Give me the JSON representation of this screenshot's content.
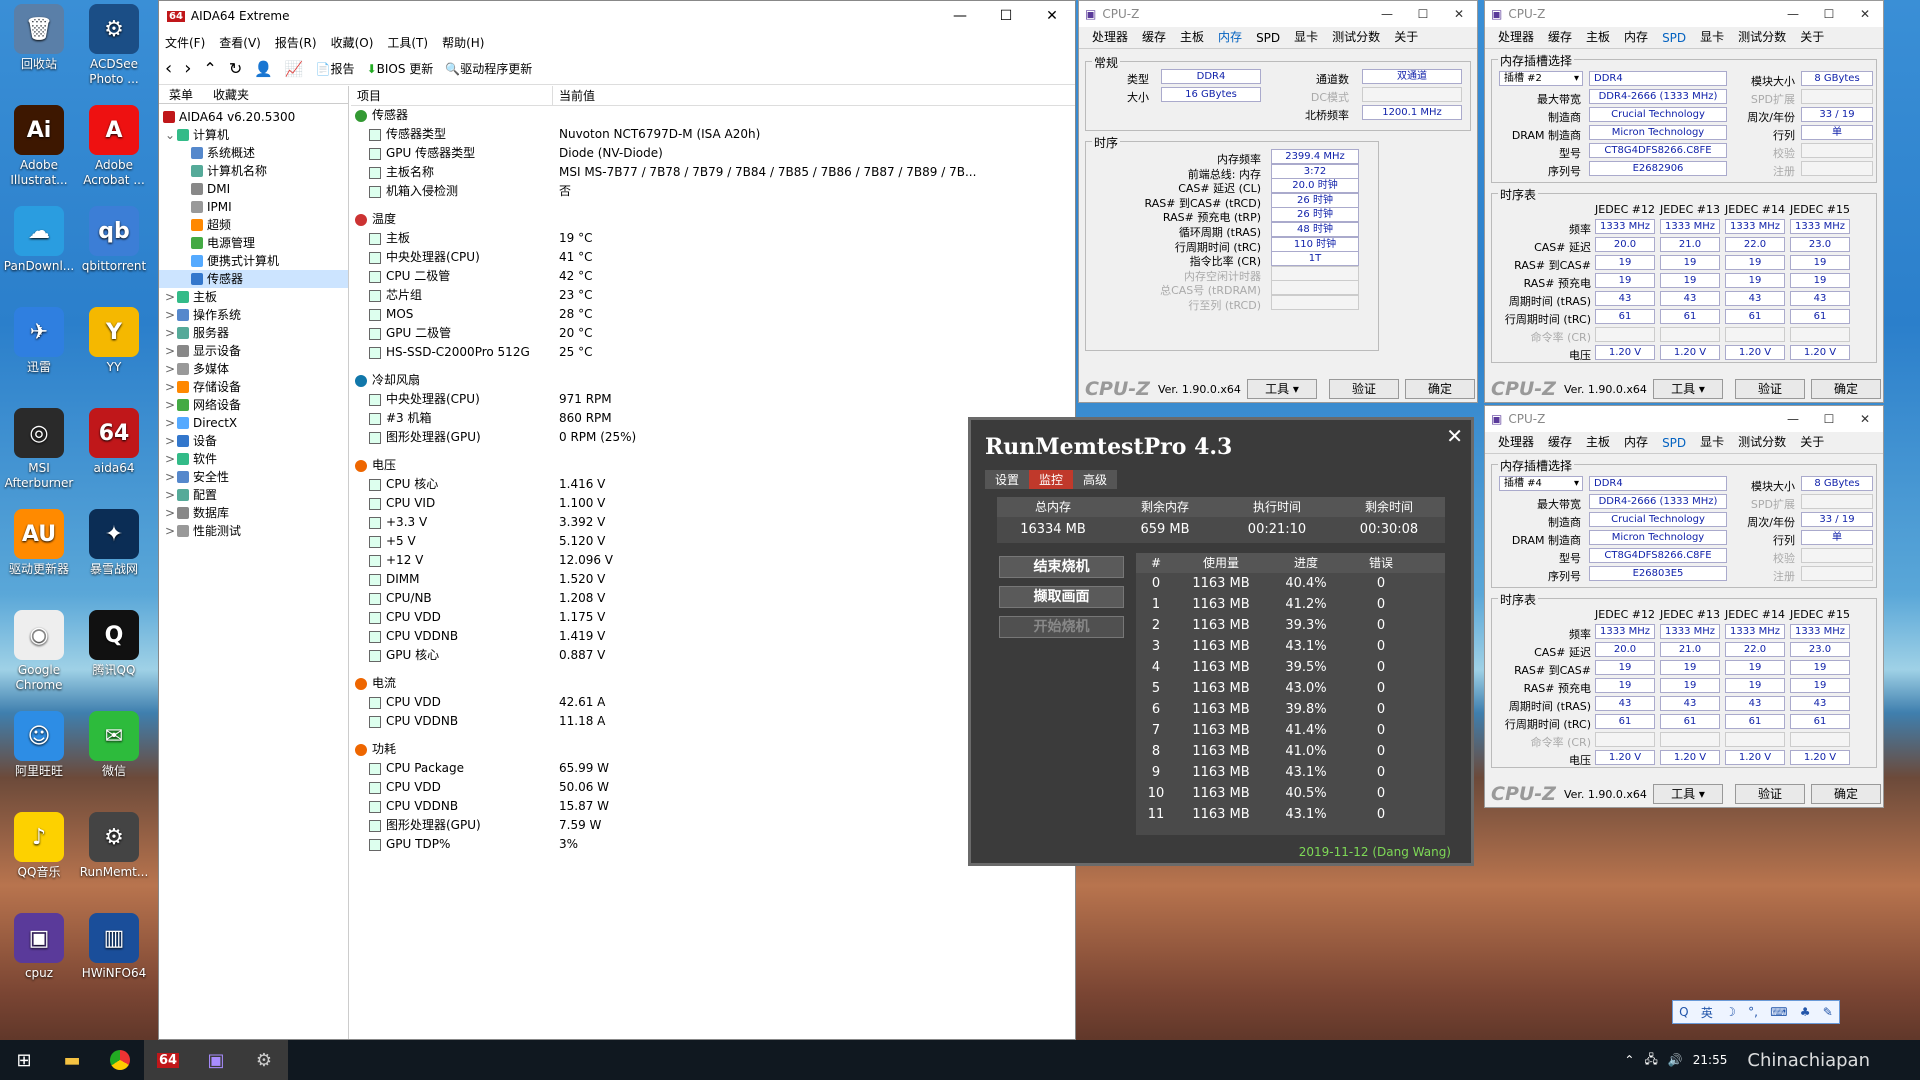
{
  "desktop": {
    "icons": [
      {
        "label": "回收站",
        "color": "#5a7fa8",
        "glyph": "🗑"
      },
      {
        "label": "ACDSee Photo ...",
        "color": "#1b4e86",
        "glyph": "⚙"
      },
      {
        "label": "Adobe Illustrat...",
        "color": "#3d1700",
        "glyph": "Ai"
      },
      {
        "label": "Adobe Acrobat ...",
        "color": "#e11",
        "glyph": "A"
      },
      {
        "label": "PanDownl...",
        "color": "#2a9de0",
        "glyph": "☁"
      },
      {
        "label": "qbittorrent",
        "color": "#3c7ed6",
        "glyph": "qb"
      },
      {
        "label": "迅雷",
        "color": "#2f7fe0",
        "glyph": "✈"
      },
      {
        "label": "YY",
        "color": "#f5b800",
        "glyph": "Y"
      },
      {
        "label": "MSI Afterburner",
        "color": "#2a2a2a",
        "glyph": "◎"
      },
      {
        "label": "aida64",
        "color": "#c0171a",
        "glyph": "64"
      },
      {
        "label": "驱动更新器",
        "color": "#ff8a00",
        "glyph": "AU"
      },
      {
        "label": "暴雪战网",
        "color": "#0b2d55",
        "glyph": "✦"
      },
      {
        "label": "Google Chrome",
        "color": "#eee",
        "glyph": "◉"
      },
      {
        "label": "腾讯QQ",
        "color": "#111",
        "glyph": "Q"
      },
      {
        "label": "阿里旺旺",
        "color": "#2d8de5",
        "glyph": "☺"
      },
      {
        "label": "微信",
        "color": "#2dbb3c",
        "glyph": "✉"
      },
      {
        "label": "QQ音乐",
        "color": "#fdd100",
        "glyph": "♪"
      },
      {
        "label": "RunMemt...",
        "color": "#444",
        "glyph": "⚙"
      },
      {
        "label": "cpuz",
        "color": "#5a3a9a",
        "glyph": "▣"
      },
      {
        "label": "HWiNFO64",
        "color": "#1a4e9a",
        "glyph": "▥"
      }
    ]
  },
  "aida": {
    "title": "AIDA64 Extreme",
    "menu": [
      "文件(F)",
      "查看(V)",
      "报告(R)",
      "收藏(O)",
      "工具(T)",
      "帮助(H)"
    ],
    "toolbar": {
      "report": "报告",
      "bios": "BIOS 更新",
      "driver": "驱动程序更新"
    },
    "tabs": [
      "菜单",
      "收藏夹"
    ],
    "tree_root": "AIDA64 v6.20.5300",
    "tree": [
      {
        "label": "计算机",
        "lvl": 1,
        "exp": "⌄"
      },
      {
        "label": "系统概述",
        "lvl": 2
      },
      {
        "label": "计算机名称",
        "lvl": 2
      },
      {
        "label": "DMI",
        "lvl": 2
      },
      {
        "label": "IPMI",
        "lvl": 2
      },
      {
        "label": "超频",
        "lvl": 2
      },
      {
        "label": "电源管理",
        "lvl": 2
      },
      {
        "label": "便携式计算机",
        "lvl": 2
      },
      {
        "label": "传感器",
        "lvl": 2,
        "sel": true
      },
      {
        "label": "主板",
        "lvl": 1,
        "exp": ">"
      },
      {
        "label": "操作系统",
        "lvl": 1,
        "exp": ">"
      },
      {
        "label": "服务器",
        "lvl": 1,
        "exp": ">"
      },
      {
        "label": "显示设备",
        "lvl": 1,
        "exp": ">"
      },
      {
        "label": "多媒体",
        "lvl": 1,
        "exp": ">"
      },
      {
        "label": "存储设备",
        "lvl": 1,
        "exp": ">"
      },
      {
        "label": "网络设备",
        "lvl": 1,
        "exp": ">"
      },
      {
        "label": "DirectX",
        "lvl": 1,
        "exp": ">"
      },
      {
        "label": "设备",
        "lvl": 1,
        "exp": ">"
      },
      {
        "label": "软件",
        "lvl": 1,
        "exp": ">"
      },
      {
        "label": "安全性",
        "lvl": 1,
        "exp": ">"
      },
      {
        "label": "配置",
        "lvl": 1,
        "exp": ">"
      },
      {
        "label": "数据库",
        "lvl": 1,
        "exp": ">"
      },
      {
        "label": "性能测试",
        "lvl": 1,
        "exp": ">"
      }
    ],
    "col_item": "项目",
    "col_value": "当前值",
    "sections": [
      {
        "title": "传感器",
        "rows": [
          [
            "传感器类型",
            "Nuvoton NCT6797D-M  (ISA A20h)"
          ],
          [
            "GPU 传感器类型",
            "Diode  (NV-Diode)"
          ],
          [
            "主板名称",
            "MSI MS-7B77 / 7B78 / 7B79 / 7B84 / 7B85 / 7B86 / 7B87 / 7B89 / 7B..."
          ],
          [
            "机箱入侵检测",
            "否"
          ]
        ]
      },
      {
        "title": "温度",
        "rows": [
          [
            "主板",
            "19 °C"
          ],
          [
            "中央处理器(CPU)",
            "41 °C"
          ],
          [
            "CPU 二极管",
            "42 °C"
          ],
          [
            "芯片组",
            "23 °C"
          ],
          [
            "MOS",
            "28 °C"
          ],
          [
            "GPU 二极管",
            "20 °C"
          ],
          [
            "HS-SSD-C2000Pro 512G",
            "25 °C"
          ]
        ]
      },
      {
        "title": "冷却风扇",
        "rows": [
          [
            "中央处理器(CPU)",
            "971 RPM"
          ],
          [
            "#3 机箱",
            "860 RPM"
          ],
          [
            "图形处理器(GPU)",
            "0 RPM  (25%)"
          ]
        ]
      },
      {
        "title": "电压",
        "rows": [
          [
            "CPU 核心",
            "1.416 V"
          ],
          [
            "CPU VID",
            "1.100 V"
          ],
          [
            "+3.3 V",
            "3.392 V"
          ],
          [
            "+5 V",
            "5.120 V"
          ],
          [
            "+12 V",
            "12.096 V"
          ],
          [
            "DIMM",
            "1.520 V"
          ],
          [
            "CPU/NB",
            "1.208 V"
          ],
          [
            "CPU VDD",
            "1.175 V"
          ],
          [
            "CPU VDDNB",
            "1.419 V"
          ],
          [
            "GPU 核心",
            "0.887 V"
          ]
        ]
      },
      {
        "title": "电流",
        "rows": [
          [
            "CPU VDD",
            "42.61 A"
          ],
          [
            "CPU VDDNB",
            "11.18 A"
          ]
        ]
      },
      {
        "title": "功耗",
        "rows": [
          [
            "CPU Package",
            "65.99 W"
          ],
          [
            "CPU VDD",
            "50.06 W"
          ],
          [
            "CPU VDDNB",
            "15.87 W"
          ],
          [
            "图形处理器(GPU)",
            "7.59 W"
          ],
          [
            "GPU TDP%",
            "3%"
          ]
        ]
      }
    ]
  },
  "cpuz_mem": {
    "title": "CPU-Z",
    "tabs": [
      "处理器",
      "缓存",
      "主板",
      "内存",
      "SPD",
      "显卡",
      "测试分数",
      "关于"
    ],
    "active": "内存",
    "general_label": "常规",
    "type_l": "类型",
    "type": "DDR4",
    "size_l": "大小",
    "size": "16 GBytes",
    "ch_l": "通道数",
    "ch": "双通道",
    "dc_l": "DC模式",
    "nb_l": "北桥频率",
    "nb": "1200.1 MHz",
    "timing_label": "时序",
    "timings": [
      [
        "内存频率",
        "2399.4 MHz"
      ],
      [
        "前端总线: 内存",
        "3:72"
      ],
      [
        "CAS# 延迟 (CL)",
        "20.0 时钟"
      ],
      [
        "RAS# 到CAS# (tRCD)",
        "26 时钟"
      ],
      [
        "RAS# 预充电 (tRP)",
        "26 时钟"
      ],
      [
        "循环周期 (tRAS)",
        "48 时钟"
      ],
      [
        "行周期时间 (tRC)",
        "110 时钟"
      ],
      [
        "指令比率 (CR)",
        "1T"
      ],
      [
        "内存空闲计时器",
        ""
      ],
      [
        "总CAS号 (tRDRAM)",
        ""
      ],
      [
        "行至列 (tRCD)",
        ""
      ]
    ],
    "ver": "Ver. 1.90.0.x64",
    "tools": "工具",
    "validate": "验证",
    "ok": "确定"
  },
  "cpuz_spd": [
    {
      "title": "CPU-Z",
      "slot": "插槽 #2",
      "serial": "E2682906"
    },
    {
      "title": "CPU-Z",
      "slot": "插槽 #4",
      "serial": "E26803E5"
    }
  ],
  "spd_common": {
    "tabs": [
      "处理器",
      "缓存",
      "主板",
      "内存",
      "SPD",
      "显卡",
      "测试分数",
      "关于"
    ],
    "active": "SPD",
    "slot_label": "内存插槽选择",
    "type": "DDR4",
    "module_size_l": "模块大小",
    "module_size": "8 GBytes",
    "maxbw_l": "最大带宽",
    "maxbw": "DDR4-2666 (1333 MHz)",
    "spdext_l": "SPD扩展",
    "mfr_l": "制造商",
    "mfr": "Crucial Technology",
    "week_l": "周次/年份",
    "week": "33 / 19",
    "dram_l": "DRAM 制造商",
    "dram": "Micron Technology",
    "rank_l": "行列",
    "rank": "单",
    "part_l": "型号",
    "part": "CT8G4DFS8266.C8FE",
    "chk_l": "校验",
    "serial_l": "序列号",
    "reg_l": "注册",
    "timing_label": "时序表",
    "jedec": [
      "JEDEC #12",
      "JEDEC #13",
      "JEDEC #14",
      "JEDEC #15"
    ],
    "trows": [
      [
        "频率",
        [
          "1333 MHz",
          "1333 MHz",
          "1333 MHz",
          "1333 MHz"
        ]
      ],
      [
        "CAS# 延迟",
        [
          "20.0",
          "21.0",
          "22.0",
          "23.0"
        ]
      ],
      [
        "RAS# 到CAS#",
        [
          "19",
          "19",
          "19",
          "19"
        ]
      ],
      [
        "RAS# 预充电",
        [
          "19",
          "19",
          "19",
          "19"
        ]
      ],
      [
        "周期时间 (tRAS)",
        [
          "43",
          "43",
          "43",
          "43"
        ]
      ],
      [
        "行周期时间 (tRC)",
        [
          "61",
          "61",
          "61",
          "61"
        ]
      ],
      [
        "命令率 (CR)",
        [
          "",
          "",
          "",
          ""
        ]
      ],
      [
        "电压",
        [
          "1.20 V",
          "1.20 V",
          "1.20 V",
          "1.20 V"
        ]
      ]
    ]
  },
  "rmt": {
    "title": "RunMemtestPro 4.3",
    "tabs": [
      "设置",
      "监控",
      "高级"
    ],
    "active": "监控",
    "summary_h": [
      "总内存",
      "剩余内存",
      "执行时间",
      "剩余时间"
    ],
    "summary_v": [
      "16334 MB",
      "659 MB",
      "00:21:10",
      "00:30:08"
    ],
    "btns": [
      "结束烧机",
      "撷取画面",
      "开始烧机"
    ],
    "tbl_h": [
      "#",
      "使用量",
      "进度",
      "错误"
    ],
    "rows": [
      [
        "0",
        "1163 MB",
        "40.4%",
        "0"
      ],
      [
        "1",
        "1163 MB",
        "41.2%",
        "0"
      ],
      [
        "2",
        "1163 MB",
        "39.3%",
        "0"
      ],
      [
        "3",
        "1163 MB",
        "43.1%",
        "0"
      ],
      [
        "4",
        "1163 MB",
        "39.5%",
        "0"
      ],
      [
        "5",
        "1163 MB",
        "43.0%",
        "0"
      ],
      [
        "6",
        "1163 MB",
        "39.8%",
        "0"
      ],
      [
        "7",
        "1163 MB",
        "41.4%",
        "0"
      ],
      [
        "8",
        "1163 MB",
        "41.0%",
        "0"
      ],
      [
        "9",
        "1163 MB",
        "43.1%",
        "0"
      ],
      [
        "10",
        "1163 MB",
        "40.5%",
        "0"
      ],
      [
        "11",
        "1163 MB",
        "43.1%",
        "0"
      ]
    ],
    "footer": "2019-11-12 (Dang Wang)"
  },
  "taskbar": {
    "time": "21:55",
    "ime": "英",
    "watermark": "Chinachiapan"
  }
}
